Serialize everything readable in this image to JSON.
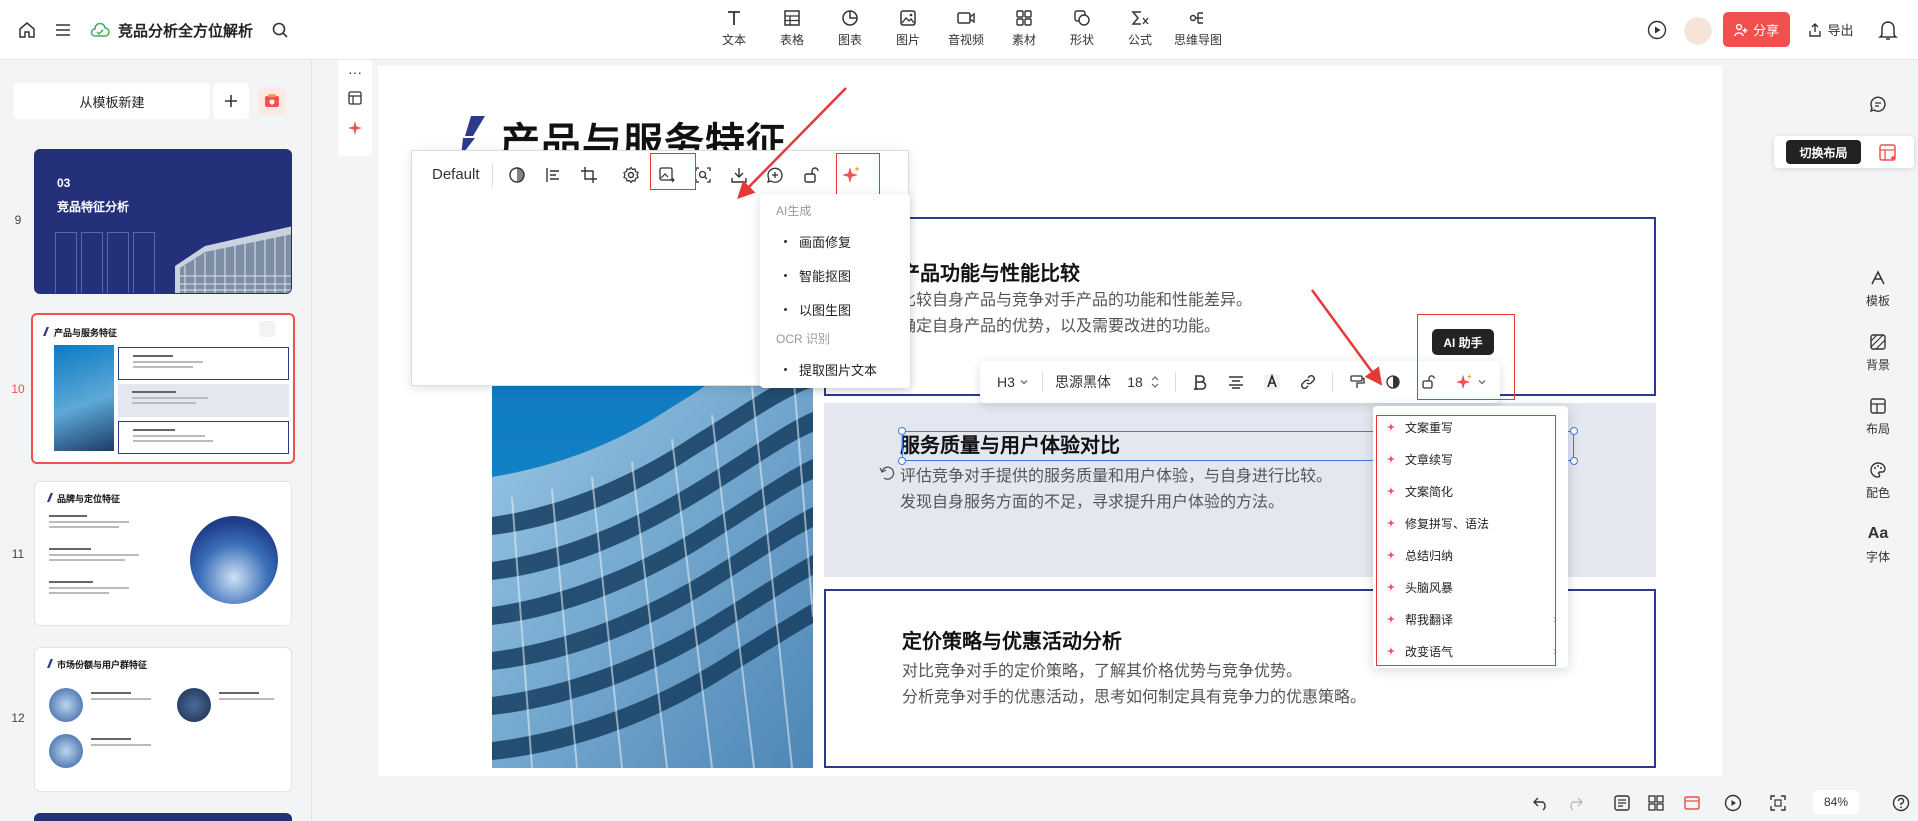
{
  "header": {
    "doc_title": "竞品分析全方位解析",
    "tools": [
      {
        "label": "文本",
        "icon": "text-icon"
      },
      {
        "label": "表格",
        "icon": "table-icon"
      },
      {
        "label": "图表",
        "icon": "chart-icon"
      },
      {
        "label": "图片",
        "icon": "image-icon"
      },
      {
        "label": "音视频",
        "icon": "video-icon"
      },
      {
        "label": "素材",
        "icon": "material-icon"
      },
      {
        "label": "形状",
        "icon": "shape-icon"
      },
      {
        "label": "公式",
        "icon": "formula-icon"
      },
      {
        "label": "思维导图",
        "icon": "mindmap-icon"
      }
    ],
    "share_label": "分享",
    "export_label": "导出"
  },
  "sidebar": {
    "new_from_template": "从模板新建",
    "slides": [
      {
        "number": "9",
        "section_no": "03",
        "title": "竞品特征分析"
      },
      {
        "number": "10",
        "title": "产品与服务特征",
        "active": true
      },
      {
        "number": "11",
        "title": "品牌与定位特征"
      },
      {
        "number": "12",
        "title": "市场份额与用户群特征"
      }
    ]
  },
  "slide": {
    "title": "产品与服务特征",
    "boxes": [
      {
        "title": "产品功能与性能比较",
        "lines": [
          "比较自身产品与竞争对手产品的功能和性能差异。",
          "确定自身产品的优势，以及需要改进的功能。"
        ]
      },
      {
        "title": "服务质量与用户体验对比",
        "lines": [
          "评估竞争对手提供的服务质量和用户体验，与自身进行比较。",
          "发现自身服务方面的不足，寻求提升用户体验的方法。"
        ]
      },
      {
        "title": "定价策略与优惠活动分析",
        "lines": [
          "对比竞争对手的定价策略，了解其价格优势与竞争优势。",
          "分析竞争对手的优惠活动，思考如何制定具有竞争力的优惠策略。"
        ]
      }
    ]
  },
  "image_toolbar": {
    "style_label": "Default",
    "ai_menu": {
      "group_ai": "AI生成",
      "ai_items": [
        "画面修复",
        "智能抠图",
        "以图生图"
      ],
      "group_ocr": "OCR 识别",
      "ocr_items": [
        "提取图片文本"
      ]
    }
  },
  "text_toolbar": {
    "heading": "H3",
    "font": "思源黑体",
    "size": "18",
    "ai_tooltip": "AI 助手",
    "ai_items": [
      {
        "label": "文案重写",
        "submenu": false
      },
      {
        "label": "文章续写",
        "submenu": false
      },
      {
        "label": "文案简化",
        "submenu": false
      },
      {
        "label": "修复拼写、语法",
        "submenu": false
      },
      {
        "label": "总结归纳",
        "submenu": false
      },
      {
        "label": "头脑风暴",
        "submenu": false
      },
      {
        "label": "帮我翻译",
        "submenu": true
      },
      {
        "label": "改变语气",
        "submenu": true
      }
    ]
  },
  "right_rail": {
    "switch_layout_tip": "切换布局",
    "items": [
      "模板",
      "背景",
      "布局",
      "配色",
      "字体"
    ]
  },
  "bottom": {
    "zoom": "84%"
  },
  "colors": {
    "accent": "#f2504f",
    "slide_border": "#2d3a8c",
    "selection": "#3b7de0",
    "annotation": "#e53935"
  }
}
